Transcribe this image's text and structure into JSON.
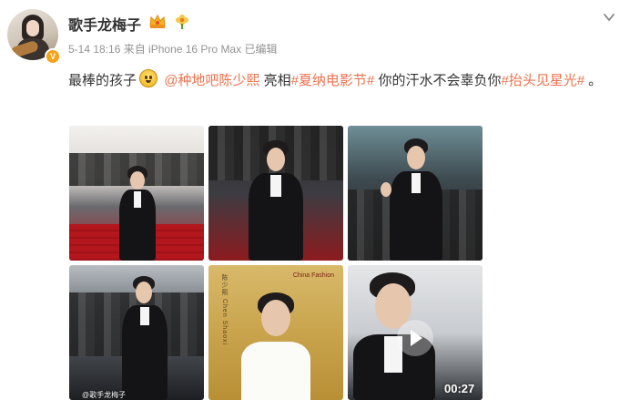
{
  "post": {
    "username": "歌手龙梅子",
    "meta": "5-14 18:16 来自 iPhone 16 Pro Max 已编辑",
    "text_prefix": "最棒的孩子",
    "mention": "@种地吧陈少熙",
    "text_mid1": " 亮相",
    "topic1": "#夏纳电影节#",
    "text_mid2": " 你的汗水不会辜负你",
    "topic2": "#抬头见星光#",
    "text_suffix": " 。"
  },
  "badges": {
    "verified": "V",
    "crown_icon": "crown-badge-icon",
    "flower_icon": "flower-badge-icon"
  },
  "media": {
    "watermark": "@歌手龙梅子",
    "video_duration": "00:27",
    "poster_vertical_text": "陈少熙 Chen Shaoxi",
    "poster_brand": "China Fashion"
  },
  "colors": {
    "link": "#eb7350",
    "meta": "#939393",
    "text": "#333333"
  }
}
